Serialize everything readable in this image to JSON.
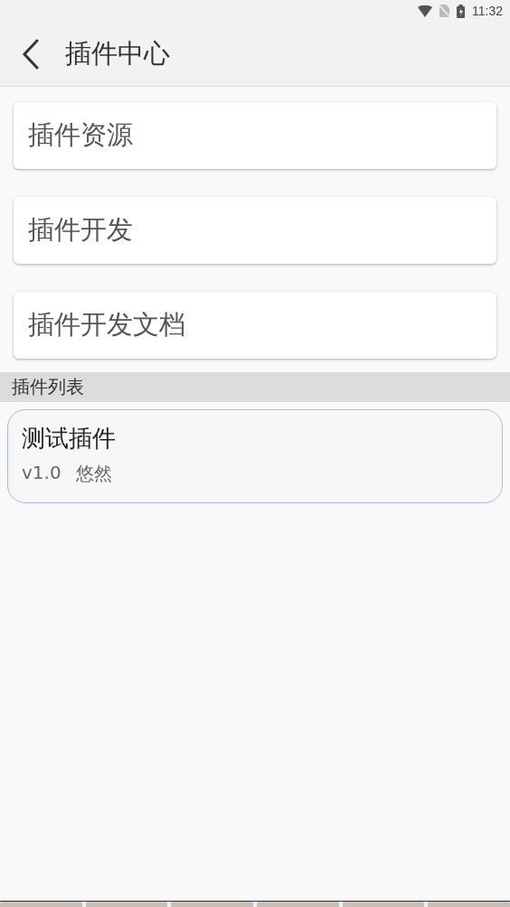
{
  "status_bar": {
    "time": "11:32"
  },
  "app_bar": {
    "title": "插件中心"
  },
  "menu_items": [
    {
      "label": "插件资源"
    },
    {
      "label": "插件开发"
    },
    {
      "label": "插件开发文档"
    }
  ],
  "section": {
    "title": "插件列表"
  },
  "plugins": [
    {
      "name": "测试插件",
      "version": "v1.0",
      "author": "悠然"
    }
  ]
}
